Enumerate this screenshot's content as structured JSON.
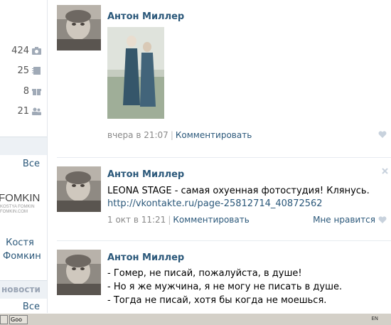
{
  "sidebar": {
    "stats": [
      {
        "value": "424",
        "icon": "camera-icon"
      },
      {
        "value": "25",
        "icon": "notebook-icon"
      },
      {
        "value": "8",
        "icon": "gift-icon"
      },
      {
        "value": "21",
        "icon": "people-icon"
      }
    ],
    "section1_all": "Все",
    "logo_main": "FOMKIN",
    "logo_sub": "KOSTYA FOMKIN\nFOMKIN.COM",
    "person_name_first": "Костя",
    "person_name_last": "Фомкин",
    "section2_title": "новости",
    "section2_all": "Все"
  },
  "feed": {
    "posts": [
      {
        "author": "Антон Миллер",
        "meta_time": "вчера в 21:07",
        "meta_comment": "Комментировать"
      },
      {
        "author": "Антон Миллер",
        "text": "LEONA STAGE - самая охуенная фотостудия! Клянусь.",
        "link": "http://vkontakte.ru/page-25812714_40872562",
        "meta_time": "1 окт в 11:21",
        "meta_comment": "Комментировать",
        "like": "Мне нравится"
      },
      {
        "author": "Антон Миллер",
        "lines": [
          "- Гомер, не писай, пожалуйста, в душе!",
          "- Но я же мужчина, я не могу не писать в душе.",
          "- Тогда не писай, хотя бы когда не моешься."
        ]
      }
    ]
  },
  "taskbar": {
    "button1": "",
    "button2": "Goo",
    "lang": "EN"
  },
  "colors": {
    "link": "#2b587a",
    "meta": "#888888",
    "section_bg": "#edf1f5"
  }
}
